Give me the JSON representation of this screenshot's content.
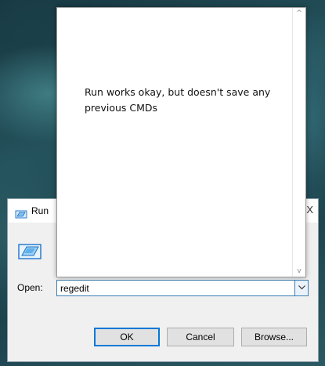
{
  "run_dialog": {
    "title": "Run",
    "close_glyph": "X",
    "open_label": "Open:",
    "open_value": "regedit",
    "buttons": {
      "ok": "OK",
      "cancel": "Cancel",
      "browse": "Browse..."
    },
    "icons": {
      "title": "run-app-icon",
      "body": "run-app-icon-large",
      "dropdown": "chevron-down-icon"
    }
  },
  "note_window": {
    "text": "Run works okay, but doesn't save any previous CMDs",
    "scroll_up_glyph": "^",
    "scroll_down_glyph": "v"
  },
  "colors": {
    "accent": "#0078d7",
    "dialog_bg": "#f0f0f0"
  }
}
